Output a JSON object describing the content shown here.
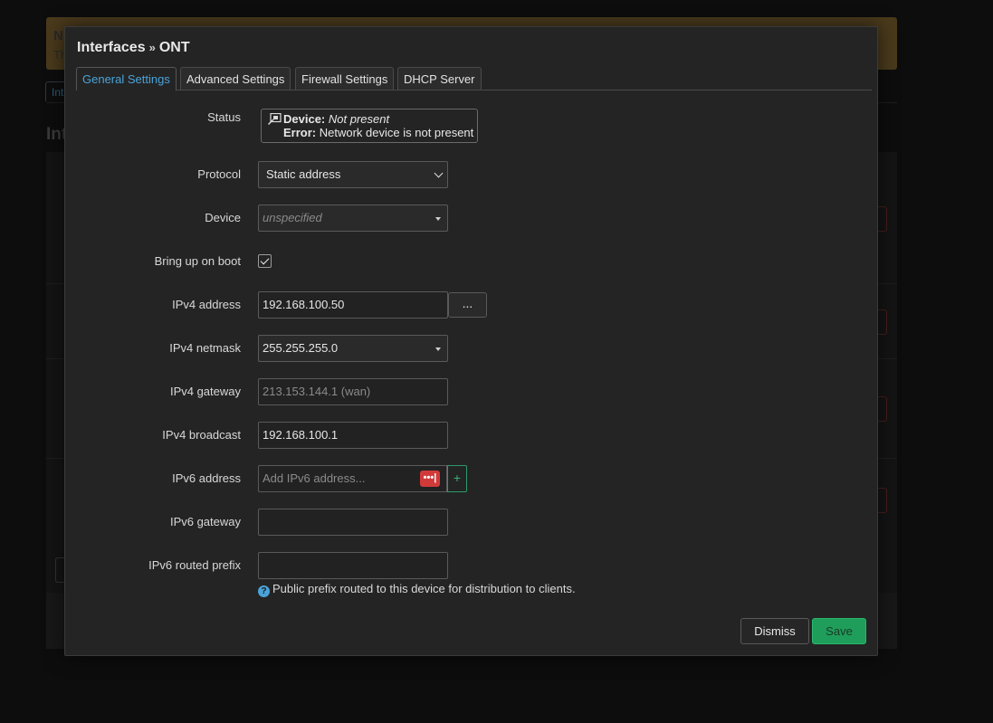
{
  "background": {
    "alert_title": "N",
    "alert_text": "Th",
    "tab_label": "Int",
    "heading": "Int"
  },
  "modal": {
    "title": "Interfaces",
    "title_separator": "»",
    "interface_name": "ONT"
  },
  "tabs": [
    {
      "label": "General Settings",
      "active": true
    },
    {
      "label": "Advanced Settings",
      "active": false
    },
    {
      "label": "Firewall Settings",
      "active": false
    },
    {
      "label": "DHCP Server",
      "active": false
    }
  ],
  "status": {
    "label": "Status",
    "device_key": "Device:",
    "device_value": "Not present",
    "error_key": "Error:",
    "error_value": "Network device is not present"
  },
  "protocol": {
    "label": "Protocol",
    "value": "Static address"
  },
  "device": {
    "label": "Device",
    "value": "unspecified"
  },
  "boot": {
    "label": "Bring up on boot",
    "checked": true
  },
  "ipv4_address": {
    "label": "IPv4 address",
    "value": "192.168.100.50",
    "more_label": "..."
  },
  "ipv4_netmask": {
    "label": "IPv4 netmask",
    "value": "255.255.255.0"
  },
  "ipv4_gateway": {
    "label": "IPv4 gateway",
    "placeholder": "213.153.144.1 (wan)"
  },
  "ipv4_broadcast": {
    "label": "IPv4 broadcast",
    "value": "192.168.100.1"
  },
  "ipv6_address": {
    "label": "IPv6 address",
    "placeholder": "Add IPv6 address...",
    "badge": "•••|",
    "add_label": "+"
  },
  "ipv6_gateway": {
    "label": "IPv6 gateway",
    "value": ""
  },
  "ipv6_prefix": {
    "label": "IPv6 routed prefix",
    "value": "",
    "help": "Public prefix routed to this device for distribution to clients."
  },
  "buttons": {
    "dismiss": "Dismiss",
    "save": "Save"
  },
  "colors": {
    "accent": "#4aa3d8",
    "save": "#1e9e5a",
    "danger": "#d23a3a",
    "warning_bg": "#4a3a1c"
  }
}
